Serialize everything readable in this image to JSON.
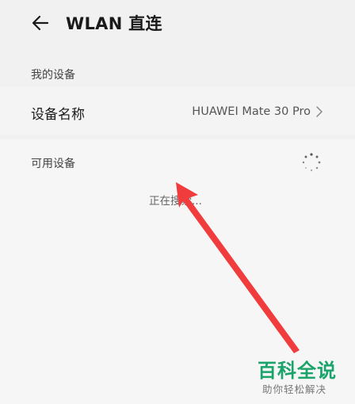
{
  "header": {
    "title": "WLAN 直连",
    "back_icon": "arrow-left-icon"
  },
  "my_devices": {
    "section_label": "我的设备",
    "device_name_label": "设备名称",
    "device_name_value": "HUAWEI Mate 30 Pro",
    "chevron_icon": "chevron-right-icon"
  },
  "available_devices": {
    "section_label": "可用设备",
    "spinner_icon": "loading-spinner-icon",
    "status_text": "正在搜索..."
  },
  "watermark": {
    "brand": "百科全说",
    "tagline": "助你轻松解决"
  },
  "colors": {
    "annotation_arrow": "#f03c3c",
    "watermark_green": "#1aa36a"
  }
}
